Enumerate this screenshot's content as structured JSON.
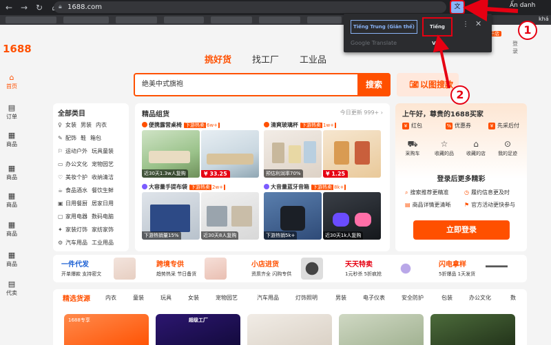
{
  "browser": {
    "url": "1688.com",
    "profile_label": "Ẩn danh",
    "bookmark_right": "khá",
    "translate_icon": "translate-icon"
  },
  "translate_popup": {
    "lang_source": "Tiếng Trung (Giản thể)",
    "lang_target": "Tiếng Việt",
    "footer": "Google Translate"
  },
  "header": {
    "logo": "1688",
    "order_badge": "开店",
    "login_link": "登录"
  },
  "rail": [
    {
      "icon": "⌂",
      "label": "首页",
      "active": true
    },
    {
      "icon": "▤",
      "label": "订单",
      "active": false
    },
    {
      "icon": "▦",
      "label": "商品",
      "active": false
    },
    {
      "icon": "▦",
      "label": "商品",
      "active": false
    },
    {
      "icon": "▦",
      "label": "商品",
      "active": false
    },
    {
      "icon": "▦",
      "label": "商品",
      "active": false
    },
    {
      "icon": "▦",
      "label": "商品",
      "active": false
    },
    {
      "icon": "▤",
      "label": "代卖",
      "active": false
    }
  ],
  "search": {
    "tabs": [
      "挑好货",
      "找工厂",
      "工业品"
    ],
    "value": "绝美中式旗袍",
    "button": "搜索",
    "image_search": "以图搜款"
  },
  "categories": {
    "title": "全部类目",
    "rows": [
      {
        "icon": "♀",
        "items": [
          "女装",
          "男装",
          "内衣"
        ]
      },
      {
        "icon": "✎",
        "items": [
          "配饰",
          "鞋",
          "箱包"
        ]
      },
      {
        "icon": "⚐",
        "items": [
          "运动户外",
          "玩具童装"
        ]
      },
      {
        "icon": "▭",
        "items": [
          "办公文化",
          "宠物园艺"
        ]
      },
      {
        "icon": "♡",
        "items": [
          "美妆个护",
          "收纳清洁"
        ]
      },
      {
        "icon": "☕",
        "items": [
          "食品酒水",
          "餐饮生鲜"
        ]
      },
      {
        "icon": "▣",
        "items": [
          "日用餐厨",
          "居家日用"
        ]
      },
      {
        "icon": "▢",
        "items": [
          "家用电器",
          "数码电脑"
        ]
      },
      {
        "icon": "✦",
        "items": [
          "家装灯饰",
          "家纺家饰"
        ]
      },
      {
        "icon": "⚙",
        "items": [
          "汽车用品",
          "工业用品"
        ]
      }
    ]
  },
  "promo": {
    "title": "精品组货",
    "updated": "今日更新 999+ ›",
    "groups": [
      {
        "title": "便携露营桌椅",
        "tag": "下游热卖",
        "count": "6w+",
        "dot": "orange",
        "img1_label": "近30天1.3w人复购",
        "img2_price": "¥ 33.25"
      },
      {
        "title": "清爽玻璃杯",
        "tag": "下游热卖",
        "count": "1w+",
        "dot": "orange",
        "img1_label": "预估利润率70%",
        "img2_price": "¥ 1.25"
      },
      {
        "title": "大容量手提布袋",
        "tag": "下游热卖",
        "count": "2w+",
        "dot": "purple",
        "img1_label": "下游热销量15%",
        "img2_label": "近30天8人复购"
      },
      {
        "title": "大音量蓝牙音箱",
        "tag": "下游热卖",
        "count": "8k+",
        "dot": "purple",
        "img1_label": "下游热销5k+",
        "img2_label": "近30天1k人复购"
      }
    ]
  },
  "user": {
    "greeting": "上午好，尊贵的1688买家",
    "perks": [
      "红包",
      "优惠券",
      "先采后付"
    ],
    "shortcuts": [
      {
        "icon": "⛟",
        "label": "采购车"
      },
      {
        "icon": "☆",
        "label": "收藏的品"
      },
      {
        "icon": "⌂",
        "label": "收藏的店"
      },
      {
        "icon": "⊙",
        "label": "我的足迹"
      }
    ],
    "login_title": "登录后更多精彩",
    "benefits": [
      "搜索推荐更精准",
      "履约信息更及时",
      "商品详情更清晰",
      "官方活动更快参与"
    ],
    "login_button": "立即登录"
  },
  "services": [
    {
      "title": "一件代发",
      "desc": "开单爆款 支持密文",
      "color": "#ff5000"
    },
    {
      "title": "跨境专供",
      "desc": "趋势热采 节日备货",
      "color": "#ff5000"
    },
    {
      "title": "小店进货",
      "desc": "资质齐全 闪购专供",
      "color": "#ff5000"
    },
    {
      "title": "天天特卖",
      "desc": "1元秒杀 5折疯抢",
      "color": "#e60012"
    },
    {
      "title": "闪电拿样",
      "desc": "5折爆品 1天发货",
      "color": "#ff5000"
    }
  ],
  "category_tabs": [
    "精选货源",
    "内衣",
    "童装",
    "玩具",
    "女装",
    "宠物园艺",
    "汽车用品",
    "灯饰照明",
    "男装",
    "电子仪表",
    "安全防护",
    "包装",
    "办公文化",
    "数"
  ],
  "products": [
    {
      "label": "1688专享"
    },
    {
      "label": "超级工厂"
    },
    {
      "label": ""
    },
    {
      "label": ""
    },
    {
      "label": ""
    }
  ],
  "annotations": [
    "1",
    "2"
  ],
  "colors": {
    "brand": "#ff5000",
    "annotation": "#e60012"
  }
}
